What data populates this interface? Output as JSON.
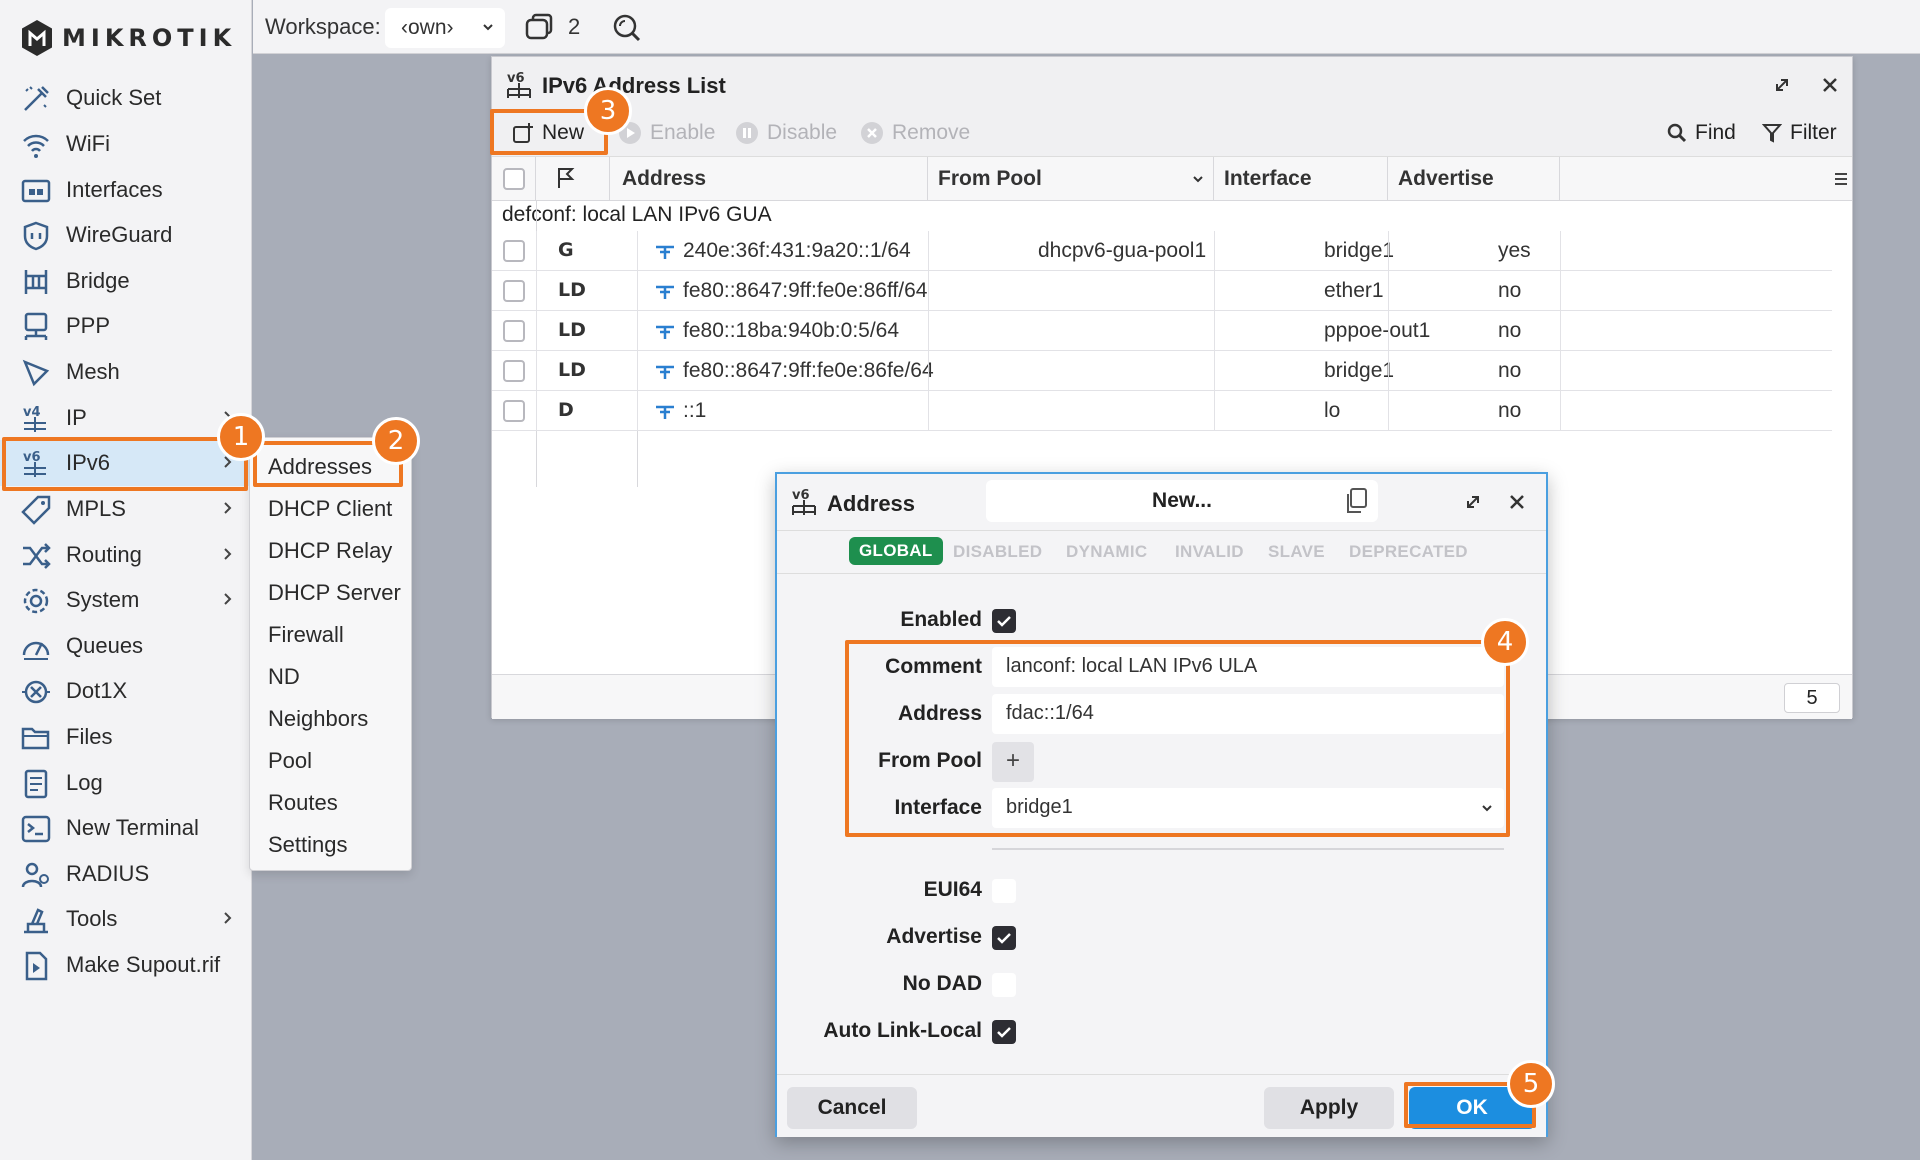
{
  "brand": {
    "name": "MIKROTIK"
  },
  "topbar": {
    "workspace_label": "Workspace:",
    "workspace_value": "‹own›",
    "window_count": "2"
  },
  "sidebar": {
    "items": [
      {
        "label": "Quick Set",
        "icon": "quick-set-icon"
      },
      {
        "label": "WiFi",
        "icon": "wifi-icon"
      },
      {
        "label": "Interfaces",
        "icon": "interfaces-icon"
      },
      {
        "label": "WireGuard",
        "icon": "wireguard-icon"
      },
      {
        "label": "Bridge",
        "icon": "bridge-icon"
      },
      {
        "label": "PPP",
        "icon": "ppp-icon"
      },
      {
        "label": "Mesh",
        "icon": "mesh-icon"
      },
      {
        "label": "IP",
        "icon": "ip-icon"
      },
      {
        "label": "IPv6",
        "icon": "ipv6-icon"
      },
      {
        "label": "MPLS",
        "icon": "mpls-icon"
      },
      {
        "label": "Routing",
        "icon": "routing-icon"
      },
      {
        "label": "System",
        "icon": "system-icon"
      },
      {
        "label": "Queues",
        "icon": "queues-icon"
      },
      {
        "label": "Dot1X",
        "icon": "dot1x-icon"
      },
      {
        "label": "Files",
        "icon": "files-icon"
      },
      {
        "label": "Log",
        "icon": "log-icon"
      },
      {
        "label": "New Terminal",
        "icon": "terminal-icon"
      },
      {
        "label": "RADIUS",
        "icon": "radius-icon"
      },
      {
        "label": "Tools",
        "icon": "tools-icon"
      },
      {
        "label": "Make Supout.rif",
        "icon": "supout-icon"
      }
    ]
  },
  "submenu": {
    "items": [
      "Addresses",
      "DHCP Client",
      "DHCP Relay",
      "DHCP Server",
      "Firewall",
      "ND",
      "Neighbors",
      "Pool",
      "Routes",
      "Settings"
    ]
  },
  "list_window": {
    "title": "IPv6 Address List",
    "toolbar": {
      "new": "New",
      "enable": "Enable",
      "disable": "Disable",
      "remove": "Remove",
      "find": "Find",
      "filter": "Filter"
    },
    "columns": {
      "address": "Address",
      "from_pool": "From Pool",
      "interface": "Interface",
      "advertise": "Advertise"
    },
    "group": "defconf: local LAN IPv6 GUA",
    "rows": [
      {
        "flag": "G",
        "address": "240e:36f:431:9a20::1/64",
        "from_pool": "dhcpv6-gua-pool1",
        "interface": "bridge1",
        "advertise": "yes"
      },
      {
        "flag": "LD",
        "address": "fe80::8647:9ff:fe0e:86ff/64",
        "from_pool": "",
        "interface": "ether1",
        "advertise": "no"
      },
      {
        "flag": "LD",
        "address": "fe80::18ba:940b:0:5/64",
        "from_pool": "",
        "interface": "pppoe-out1",
        "advertise": "no"
      },
      {
        "flag": "LD",
        "address": "fe80::8647:9ff:fe0e:86fe/64",
        "from_pool": "",
        "interface": "bridge1",
        "advertise": "no"
      },
      {
        "flag": "D",
        "address": "::1",
        "from_pool": "",
        "interface": "lo",
        "advertise": "no"
      }
    ],
    "count": "5"
  },
  "dialog": {
    "title": "Address",
    "name": "New...",
    "tabs": [
      "GLOBAL",
      "DISABLED",
      "DYNAMIC",
      "INVALID",
      "SLAVE",
      "DEPRECATED"
    ],
    "fields": {
      "enabled": {
        "label": "Enabled",
        "checked": true
      },
      "comment": {
        "label": "Comment",
        "value": "lanconf: local LAN IPv6 ULA"
      },
      "address": {
        "label": "Address",
        "value": "fdac::1/64"
      },
      "from_pool": {
        "label": "From Pool"
      },
      "interface": {
        "label": "Interface",
        "value": "bridge1"
      },
      "eui64": {
        "label": "EUI64",
        "checked": false
      },
      "advertise": {
        "label": "Advertise",
        "checked": true
      },
      "no_dad": {
        "label": "No DAD",
        "checked": false
      },
      "auto_link_local": {
        "label": "Auto Link-Local",
        "checked": true
      }
    },
    "buttons": {
      "cancel": "Cancel",
      "apply": "Apply",
      "ok": "OK"
    }
  },
  "callouts": [
    "1",
    "2",
    "3",
    "4",
    "5"
  ],
  "colors": {
    "callout": "#ee7722",
    "ok_button": "#1c8ee0",
    "global_tab": "#1e8f4e",
    "dialog_border": "#4a9fe0"
  }
}
